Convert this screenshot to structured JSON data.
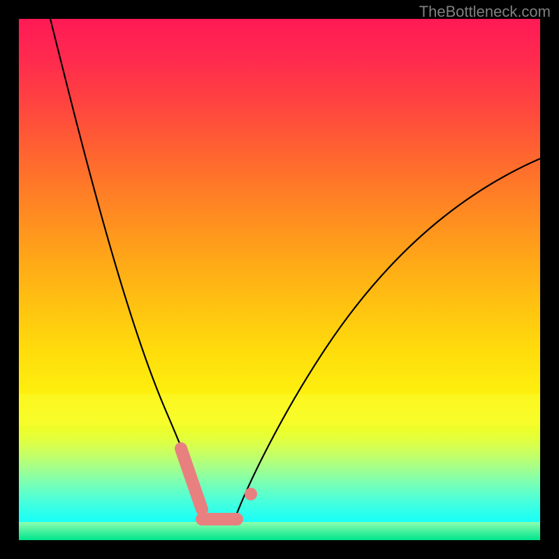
{
  "watermark": "TheBottleneck.com",
  "chart_data": {
    "type": "line",
    "title": "",
    "xlabel": "",
    "ylabel": "",
    "xlim": [
      0,
      100
    ],
    "ylim": [
      0,
      100
    ],
    "background": "rainbow-gradient-vertical",
    "description": "V-shaped bottleneck curve with minimum near x≈37, overlaid on a vertical red-to-green gradient. Pink markers highlight the low points near the trough.",
    "series": [
      {
        "name": "left-branch",
        "x": [
          6,
          8,
          10,
          12,
          14,
          16,
          18,
          20,
          22,
          24,
          26,
          28,
          30,
          32,
          34,
          36
        ],
        "y": [
          100,
          92,
          83,
          74,
          66,
          58,
          50,
          43,
          36,
          30,
          24,
          19,
          14,
          10,
          6,
          3
        ]
      },
      {
        "name": "right-branch",
        "x": [
          40,
          44,
          48,
          52,
          56,
          60,
          64,
          68,
          72,
          76,
          80,
          84,
          88,
          92,
          96,
          100
        ],
        "y": [
          3,
          7,
          12,
          17,
          23,
          29,
          35,
          41,
          47,
          53,
          58,
          63,
          67,
          70,
          72,
          73
        ]
      }
    ],
    "markers": [
      {
        "name": "left-marker-segment",
        "x": [
          30.5,
          34.5
        ],
        "y": [
          17,
          5
        ]
      },
      {
        "name": "trough-segment",
        "x": [
          34.5,
          41.5
        ],
        "y": [
          4,
          4
        ]
      },
      {
        "name": "right-marker-dot",
        "x": 44,
        "y": 8
      }
    ]
  }
}
